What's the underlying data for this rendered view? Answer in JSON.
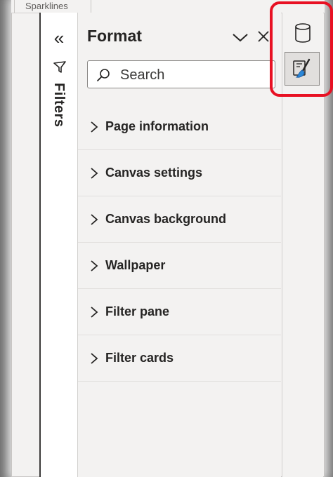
{
  "ribbon": {
    "partial_tab_label": "Sparklines"
  },
  "filters_pane": {
    "collapse_glyph": "«",
    "label": "Filters",
    "icon": "filter-funnel-icon"
  },
  "format_pane": {
    "title": "Format",
    "search": {
      "placeholder": "Search",
      "value": ""
    },
    "sections": [
      {
        "label": "Page information"
      },
      {
        "label": "Canvas settings"
      },
      {
        "label": "Canvas background"
      },
      {
        "label": "Wallpaper"
      },
      {
        "label": "Filter pane"
      },
      {
        "label": "Filter cards"
      }
    ]
  },
  "right_rail": {
    "buttons": [
      {
        "icon": "data-cylinder-icon",
        "selected": false
      },
      {
        "icon": "format-paintbrush-icon",
        "selected": true
      }
    ]
  },
  "colors": {
    "pane_background": "#f3f2f1",
    "highlight": "#e81123",
    "text": "#252423",
    "brush_accent": "#2b88d8"
  }
}
